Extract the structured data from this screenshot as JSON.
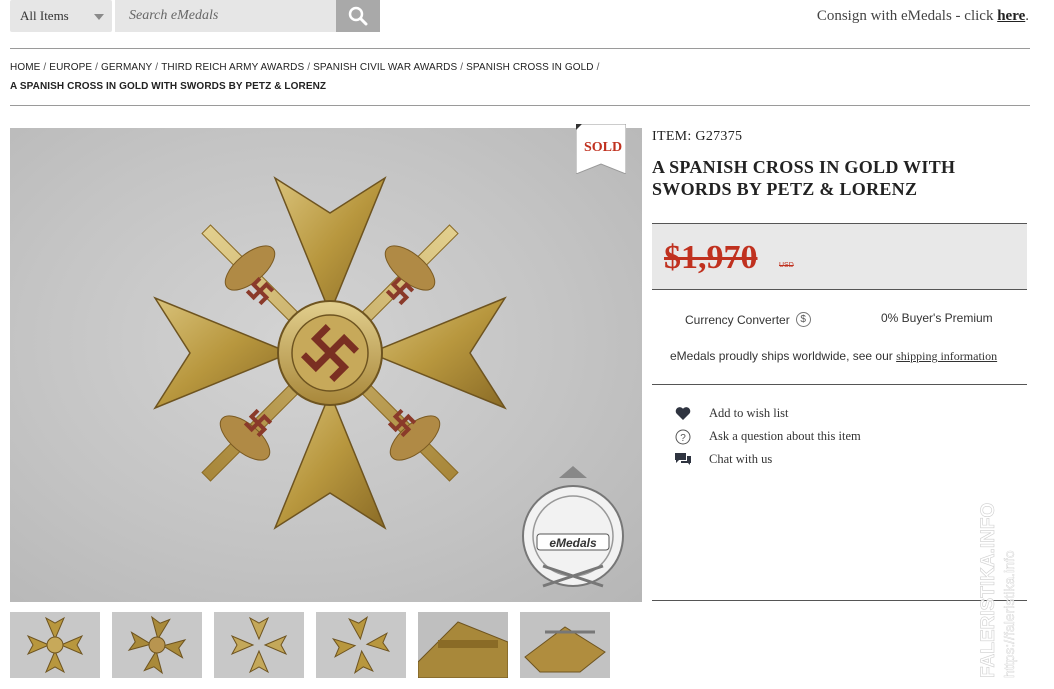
{
  "topbar": {
    "filter_label": "All Items",
    "search_placeholder": "Search eMedals",
    "consign_text": "Consign with eMedals - click ",
    "consign_link": "here",
    "consign_period": "."
  },
  "breadcrumb": {
    "items": [
      "HOME",
      "EUROPE",
      "GERMANY",
      "THIRD REICH ARMY AWARDS",
      "SPANISH CIVIL WAR AWARDS",
      "SPANISH CROSS IN GOLD"
    ],
    "current": "A SPANISH CROSS IN GOLD WITH SWORDS BY PETZ & LORENZ"
  },
  "image": {
    "sold_label": "SOLD",
    "badge_text": "eMedals",
    "badge_ring_text": "Purveyors of Authentic Militaria"
  },
  "item": {
    "code": "ITEM: G27375",
    "title": "A SPANISH CROSS IN GOLD WITH SWORDS BY PETZ & LORENZ",
    "price": "$1,970",
    "currency": "USD",
    "currency_converter": "Currency Converter",
    "buyers_premium": "0% Buyer's Premium",
    "ships_text": "eMedals proudly ships worldwide, see our ",
    "ships_link": "shipping information"
  },
  "actions": [
    {
      "label": "Add to wish list",
      "icon": "heart-icon"
    },
    {
      "label": "Ask a question about this item",
      "icon": "question-icon"
    },
    {
      "label": "Chat with us",
      "icon": "chat-icon"
    }
  ],
  "thumbnails_count": 6,
  "watermark": {
    "line1": "FALERISTIKA.INFO",
    "line2": "https://faleristika.info"
  },
  "colors": {
    "price_red": "#c0311f",
    "sold_red": "#c0311f",
    "panel_gray": "#e8e8e8",
    "search_button": "#a9a9a9"
  }
}
